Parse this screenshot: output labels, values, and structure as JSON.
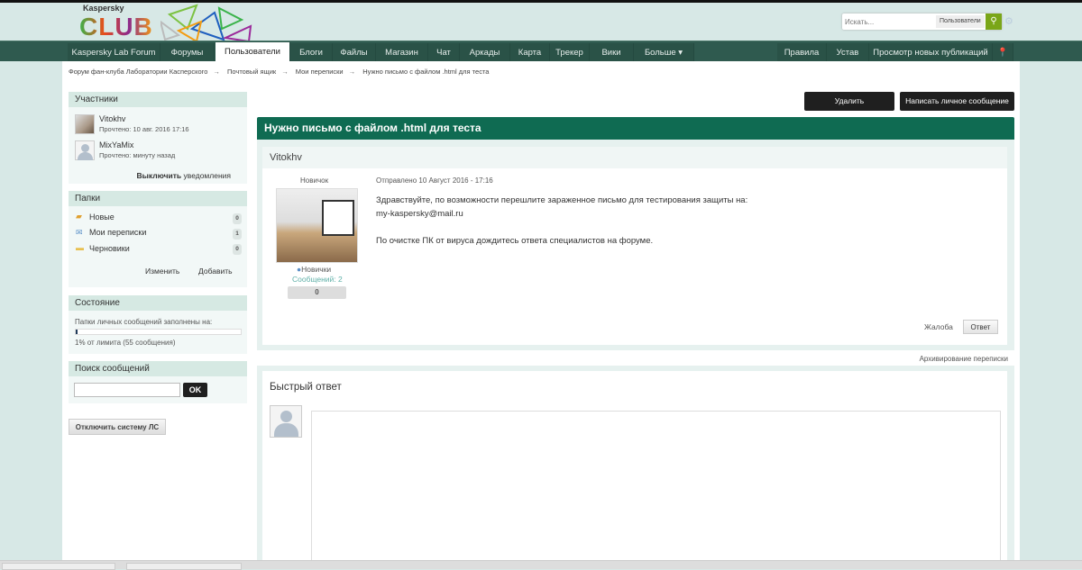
{
  "logo": {
    "brand": "Kaspersky",
    "club": "CLUB"
  },
  "search": {
    "placeholder": "Искать...",
    "scope": "Пользователи"
  },
  "nav": {
    "left": [
      "Kaspersky Lab Forum",
      "Форумы",
      "Пользователи",
      "Блоги",
      "Файлы",
      "Магазин",
      "Чат",
      "Аркады",
      "Карта",
      "Трекер",
      "Вики",
      "Больше ▾"
    ],
    "right": [
      "Правила",
      "Устав",
      "Просмотр новых публикаций"
    ],
    "active": "Пользователи"
  },
  "breadcrumb": [
    "Форум фан-клуба Лаборатории Касперского",
    "Почтовый ящик",
    "Мои переписки",
    "Нужно письмо с файлом .html для теста"
  ],
  "breadcrumb_sep": "→",
  "participants": {
    "title": "Участники",
    "users": [
      {
        "name": "Vitokhv",
        "read": "Прочтено: 10 авг. 2016 17:16"
      },
      {
        "name": "MixYaMix",
        "read": "Прочтено: минуту назад"
      }
    ],
    "notify_bold": "Выключить",
    "notify_rest": " уведомления"
  },
  "folders": {
    "title": "Папки",
    "items": [
      {
        "label": "Новые",
        "count": "0"
      },
      {
        "label": "Мои переписки",
        "count": "1"
      },
      {
        "label": "Черновики",
        "count": "0"
      }
    ],
    "edit": "Изменить",
    "add": "Добавить"
  },
  "status": {
    "title": "Состояние",
    "label": "Папки личных сообщений заполнены на:",
    "percent": 1,
    "note": "1% от лимита (55 сообщения)"
  },
  "msg_search": {
    "title": "Поиск сообщений",
    "ok": "OK"
  },
  "disable_pm": "Отключить систему ЛС",
  "actions": {
    "delete": "Удалить",
    "compose": "Написать личное сообщение"
  },
  "topic": {
    "title": "Нужно письмо с файлом .html для теста"
  },
  "post": {
    "author": "Vitokhv",
    "rank": "Новичок",
    "group": "Новички",
    "posts": "Сообщений: 2",
    "rep": "0",
    "sent": "Отправлено 10 Август 2016 - 17:16",
    "lines": [
      "Здравствуйте, по возможности перешлите зараженное письмо для тестирования защиты на:",
      "my-kaspersky@mail.ru",
      "",
      "По очистке ПК от вируса дождитесь ответа специалистов на форуме."
    ],
    "report": "Жалоба",
    "reply": "Ответ"
  },
  "archive": "Архивирование переписки",
  "quick_reply": {
    "title": "Быстрый ответ"
  },
  "colors": {
    "nav": "#2f5a4f",
    "title": "#0f6b52",
    "accent": "#7aa618"
  }
}
